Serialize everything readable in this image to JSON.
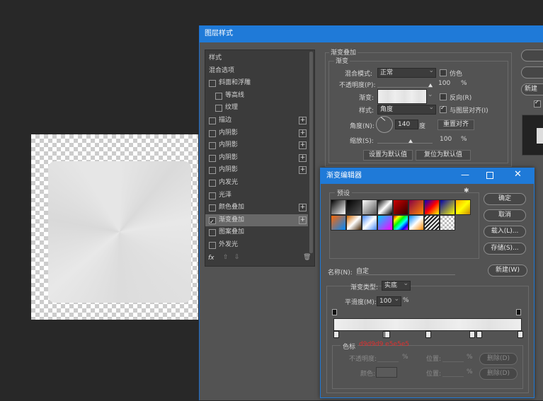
{
  "layer_style": {
    "title": "图层样式",
    "sidebar": [
      {
        "label": "样式",
        "checkbox": false,
        "plus": false,
        "indent": 0
      },
      {
        "label": "混合选项",
        "checkbox": false,
        "plus": false,
        "indent": 0
      },
      {
        "label": "斜面和浮雕",
        "checkbox": true,
        "checked": false,
        "plus": false,
        "indent": 0
      },
      {
        "label": "等高线",
        "checkbox": true,
        "checked": false,
        "plus": false,
        "indent": 1
      },
      {
        "label": "纹理",
        "checkbox": true,
        "checked": false,
        "plus": false,
        "indent": 1
      },
      {
        "label": "描边",
        "checkbox": true,
        "checked": false,
        "plus": true,
        "indent": 0
      },
      {
        "label": "内阴影",
        "checkbox": true,
        "checked": false,
        "plus": true,
        "indent": 0
      },
      {
        "label": "内阴影",
        "checkbox": true,
        "checked": false,
        "plus": true,
        "indent": 0
      },
      {
        "label": "内阴影",
        "checkbox": true,
        "checked": false,
        "plus": true,
        "indent": 0
      },
      {
        "label": "内阴影",
        "checkbox": true,
        "checked": false,
        "plus": true,
        "indent": 0
      },
      {
        "label": "内发光",
        "checkbox": true,
        "checked": false,
        "plus": false,
        "indent": 0
      },
      {
        "label": "光泽",
        "checkbox": true,
        "checked": false,
        "plus": false,
        "indent": 0
      },
      {
        "label": "颜色叠加",
        "checkbox": true,
        "checked": false,
        "plus": true,
        "indent": 0
      },
      {
        "label": "渐变叠加",
        "checkbox": true,
        "checked": true,
        "plus": true,
        "indent": 0,
        "selected": true
      },
      {
        "label": "图案叠加",
        "checkbox": true,
        "checked": false,
        "plus": false,
        "indent": 0
      },
      {
        "label": "外发光",
        "checkbox": true,
        "checked": false,
        "plus": false,
        "indent": 0
      }
    ],
    "fx_label": "fx",
    "section_title": "渐变叠加",
    "subsection_title": "渐变",
    "blend_mode_label": "混合模式:",
    "blend_mode_value": "正常",
    "dither_label": "仿色",
    "opacity_label": "不透明度(P):",
    "opacity_value": "100",
    "percent": "%",
    "gradient_label": "渐变:",
    "reverse_label": "反向(R)",
    "style_label": "样式:",
    "style_value": "角度",
    "align_label": "与图层对齐(I)",
    "angle_label": "角度(N):",
    "angle_value": "140",
    "degree_unit": "度",
    "reset_align_button": "重置对齐",
    "scale_label": "缩放(S):",
    "scale_value": "100",
    "set_default_button": "设置为默认值",
    "reset_default_button": "复位为默认值",
    "new_button_partial": "新建"
  },
  "gradient_editor": {
    "title": "渐变编辑器",
    "presets_label": "预设",
    "ok_button": "确定",
    "cancel_button": "取消",
    "load_button": "载入(L)...",
    "save_button": "存储(S)...",
    "name_label": "名称(N):",
    "name_value": "自定",
    "new_button": "新建(W)",
    "gradient_type_label": "渐变类型:",
    "gradient_type_value": "实底",
    "smoothness_label": "平滑度(M):",
    "smoothness_value": "100",
    "percent": "%",
    "stops_group_label": "色标",
    "stops_annotation": "d9d9d9 e5e5e5",
    "opacity_label": "不透明度:",
    "location_label": "位置:",
    "delete_button": "删除(D)",
    "color_label": "颜色:"
  },
  "colors": {
    "accent": "#1f7ad8",
    "annotation": "#e03030"
  },
  "presets": [
    "linear-gradient(135deg,#000,#fff)",
    "linear-gradient(135deg,#000,rgba(0,0,0,0))",
    "linear-gradient(135deg,#fff,rgba(255,255,255,0))",
    "linear-gradient(135deg,#000,#fff,#000)",
    "linear-gradient(135deg,#c00,#300)",
    "linear-gradient(135deg,#804,#f80)",
    "linear-gradient(135deg,#00c,#f00,#ff0)",
    "linear-gradient(135deg,#00a,#ff0)",
    "linear-gradient(135deg,#fa0,#ff0,#c80)",
    "linear-gradient(135deg,#f60,#08f)",
    "linear-gradient(135deg,#c60,#fff,#420)",
    "linear-gradient(135deg,#48f,#fff,#48f)",
    "linear-gradient(135deg,#0cf,#f0f)",
    "linear-gradient(135deg,#f00,#ff0,#0f0,#0ff,#00f,#f0f)",
    "linear-gradient(135deg,#08f,#fff,#f80)",
    "repeating-linear-gradient(135deg,#222 0 2px,#eee 2px 4px)",
    "linear-gradient(135deg,#ccc,#fff)"
  ],
  "gradient_bar_colors": [
    "#eeeeee",
    "#e2e2e2",
    "#eeeeee",
    "#e2e2e2",
    "#eeeeee",
    "#e2e2e2",
    "#eeeeee"
  ],
  "preview_colors": [
    "#ebebeb",
    "#dcdcdc",
    "#e6e6e6",
    "#dadada",
    "#e8e8e8"
  ]
}
